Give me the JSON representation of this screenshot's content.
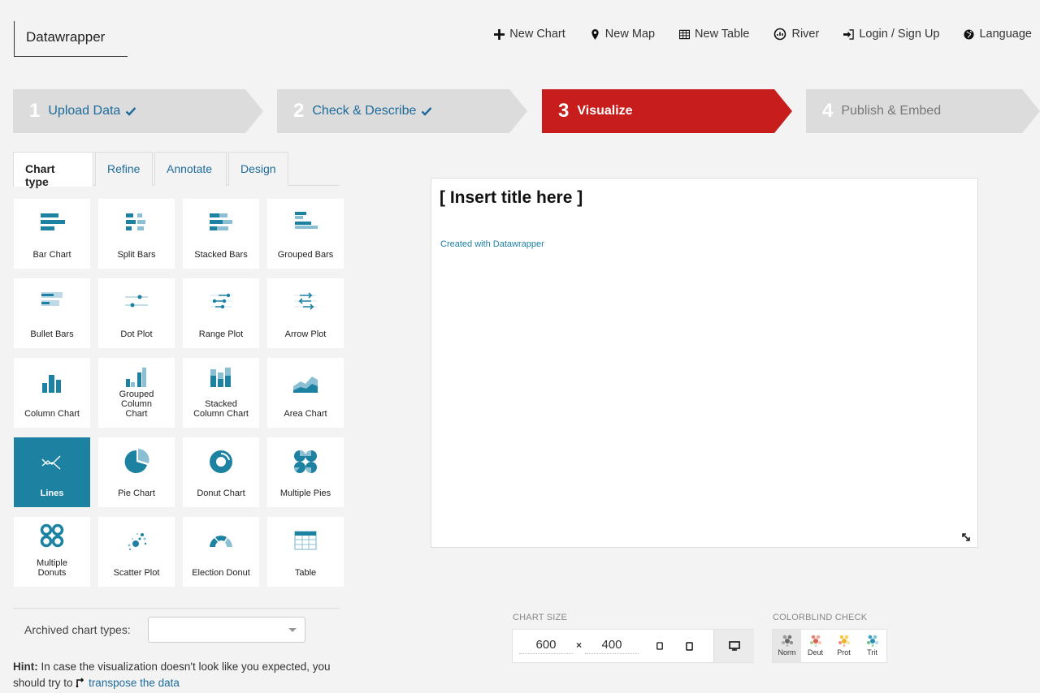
{
  "app": {
    "logo": "Datawrapper"
  },
  "nav": [
    {
      "label": "New Chart",
      "icon": "plus-icon"
    },
    {
      "label": "New Map",
      "icon": "map-marker-icon"
    },
    {
      "label": "New Table",
      "icon": "table-icon"
    },
    {
      "label": "River",
      "icon": "river-icon"
    },
    {
      "label": "Login / Sign Up",
      "icon": "sign-in-icon"
    },
    {
      "label": "Language",
      "icon": "globe-icon"
    }
  ],
  "steps": [
    {
      "num": "1",
      "label": "Upload Data",
      "state": "done"
    },
    {
      "num": "2",
      "label": "Check & Describe",
      "state": "done"
    },
    {
      "num": "3",
      "label": "Visualize",
      "state": "active"
    },
    {
      "num": "4",
      "label": "Publish & Embed",
      "state": "disabled"
    }
  ],
  "tabs": [
    "Chart type",
    "Refine",
    "Annotate",
    "Design"
  ],
  "active_tab": "Chart type",
  "chart_types": [
    {
      "label": "Bar Chart",
      "icon": "bar-chart-icon"
    },
    {
      "label": "Split Bars",
      "icon": "split-bars-icon"
    },
    {
      "label": "Stacked Bars",
      "icon": "stacked-bars-icon"
    },
    {
      "label": "Grouped Bars",
      "icon": "grouped-bars-icon"
    },
    {
      "label": "Bullet Bars",
      "icon": "bullet-bars-icon"
    },
    {
      "label": "Dot Plot",
      "icon": "dot-plot-icon"
    },
    {
      "label": "Range Plot",
      "icon": "range-plot-icon"
    },
    {
      "label": "Arrow Plot",
      "icon": "arrow-plot-icon"
    },
    {
      "label": "Column Chart",
      "icon": "column-chart-icon"
    },
    {
      "label": "Grouped Column Chart",
      "icon": "grouped-column-chart-icon"
    },
    {
      "label": "Stacked Column Chart",
      "icon": "stacked-column-chart-icon"
    },
    {
      "label": "Area Chart",
      "icon": "area-chart-icon"
    },
    {
      "label": "Lines",
      "icon": "lines-icon"
    },
    {
      "label": "Pie Chart",
      "icon": "pie-chart-icon"
    },
    {
      "label": "Donut Chart",
      "icon": "donut-chart-icon"
    },
    {
      "label": "Multiple Pies",
      "icon": "multiple-pies-icon"
    },
    {
      "label": "Multiple Donuts",
      "icon": "multiple-donuts-icon"
    },
    {
      "label": "Scatter Plot",
      "icon": "scatter-plot-icon"
    },
    {
      "label": "Election Donut",
      "icon": "election-donut-icon"
    },
    {
      "label": "Table",
      "icon": "table-chart-icon"
    }
  ],
  "selected_chart_type": "Lines",
  "archived": {
    "label": "Archived chart types:",
    "value": ""
  },
  "hint": {
    "bold": "Hint:",
    "text": " In case the visualization doesn't look like you expected, you should try to ",
    "link": "transpose the data"
  },
  "preview": {
    "title": "[ Insert title here ]",
    "credit": "Created with Datawrapper"
  },
  "chart_size": {
    "label": "CHART SIZE",
    "width": "600",
    "times": "×",
    "height": "400"
  },
  "colorblind": {
    "label": "COLORBLIND CHECK",
    "options": [
      "Norm",
      "Deut",
      "Prot",
      "Trit"
    ],
    "active": "Norm"
  },
  "colors": {
    "accent": "#1d81a2",
    "link": "#1d6b9a",
    "active_step": "#c71e1d"
  }
}
